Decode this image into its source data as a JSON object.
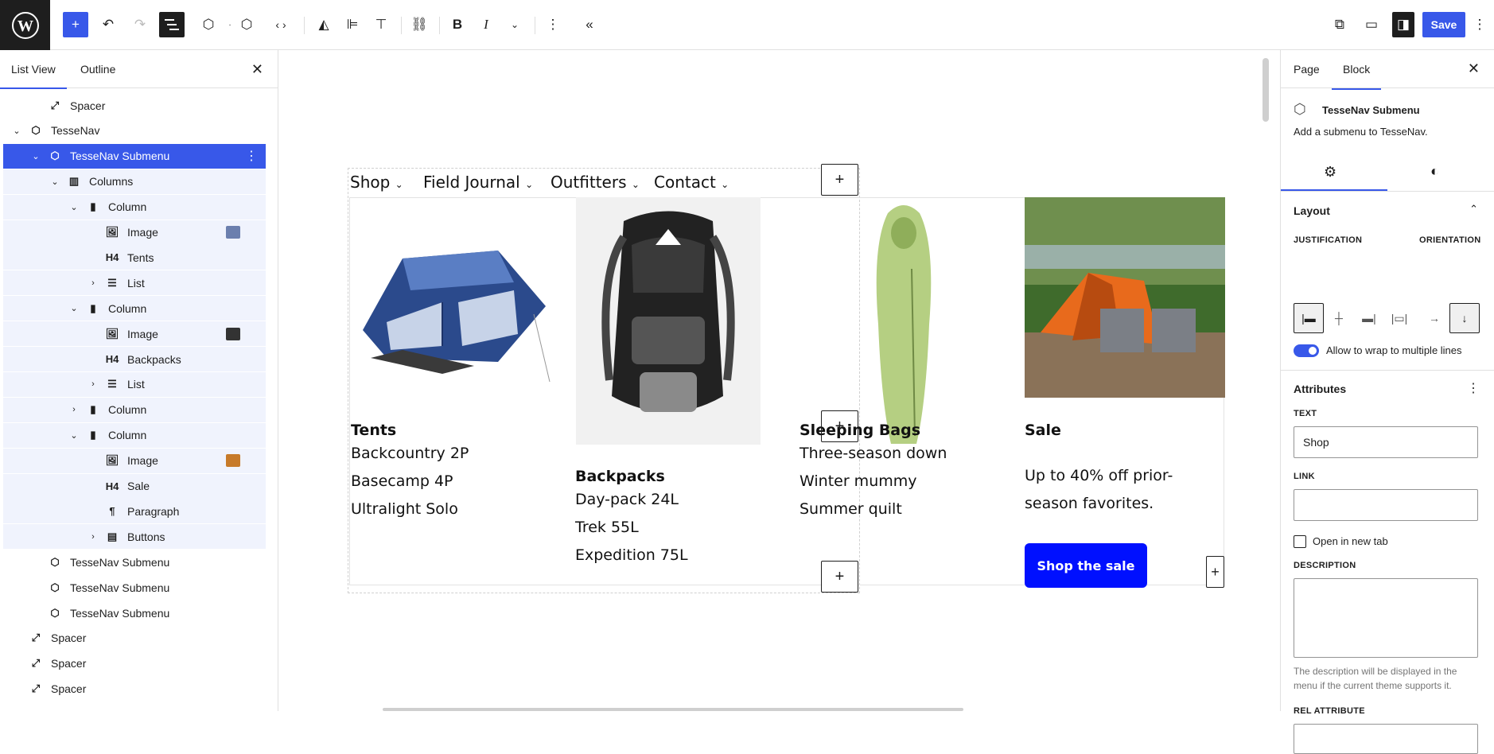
{
  "topbar": {
    "save_label": "Save"
  },
  "list_view": {
    "tabs": [
      "List View",
      "Outline"
    ],
    "rows": [
      {
        "label": "Spacer",
        "icon": "spacer-icon"
      },
      {
        "label": "TesseNav",
        "icon": "tessenav-icon"
      },
      {
        "label": "TesseNav Submenu",
        "icon": "tessenav-icon"
      },
      {
        "label": "Columns",
        "icon": "columns-icon"
      },
      {
        "label": "Column",
        "icon": "column-icon"
      },
      {
        "label": "Image",
        "icon": "image-icon"
      },
      {
        "label": "Tents",
        "icon": "h4-icon"
      },
      {
        "label": "List",
        "icon": "list-icon"
      },
      {
        "label": "Column",
        "icon": "column-icon"
      },
      {
        "label": "Image",
        "icon": "image-icon"
      },
      {
        "label": "Backpacks",
        "icon": "h4-icon"
      },
      {
        "label": "List",
        "icon": "list-icon"
      },
      {
        "label": "Column",
        "icon": "column-icon"
      },
      {
        "label": "Column",
        "icon": "column-icon"
      },
      {
        "label": "Image",
        "icon": "image-icon"
      },
      {
        "label": "Sale",
        "icon": "h4-icon"
      },
      {
        "label": "Paragraph",
        "icon": "paragraph-icon"
      },
      {
        "label": "Buttons",
        "icon": "buttons-icon"
      },
      {
        "label": "TesseNav Submenu",
        "icon": "tessenav-icon"
      },
      {
        "label": "TesseNav Submenu",
        "icon": "tessenav-icon"
      },
      {
        "label": "TesseNav Submenu",
        "icon": "tessenav-icon"
      },
      {
        "label": "Spacer",
        "icon": "spacer-icon"
      },
      {
        "label": "Spacer",
        "icon": "spacer-icon"
      },
      {
        "label": "Spacer",
        "icon": "spacer-icon"
      }
    ],
    "h4_glyph": "H4"
  },
  "canvas": {
    "nav": [
      "Shop",
      "Field Journal",
      "Outfitters",
      "Contact"
    ],
    "columns": [
      {
        "title": "Tents",
        "items": [
          "Backcountry 2P",
          "Basecamp 4P",
          "Ultralight Solo"
        ]
      },
      {
        "title": "Backpacks",
        "items": [
          "Day-pack 24L",
          "Trek 55L",
          "Expedition 75L"
        ]
      },
      {
        "title": "Sleeping Bags",
        "items": [
          "Three-season down",
          "Winter mummy",
          "Summer quilt"
        ]
      },
      {
        "title": "Sale",
        "text": "Up to 40% off prior-season favorites.",
        "button": "Shop the sale"
      }
    ]
  },
  "inspector": {
    "tabs": [
      "Page",
      "Block"
    ],
    "block_name": "TesseNav Submenu",
    "block_desc": "Add a submenu to TesseNav.",
    "layout_title": "Layout",
    "justification_label": "JUSTIFICATION",
    "orientation_label": "ORIENTATION",
    "wrap_label": "Allow to wrap to multiple lines",
    "wrap_enabled": true,
    "attributes_title": "Attributes",
    "text_label": "TEXT",
    "text_value": "Shop",
    "link_label": "LINK",
    "link_value": "",
    "new_tab_label": "Open in new tab",
    "description_label": "DESCRIPTION",
    "description_help": "The description will be displayed in the menu if the current theme supports it.",
    "rel_label": "REL ATTRIBUTE",
    "accent": "#3858e9"
  }
}
